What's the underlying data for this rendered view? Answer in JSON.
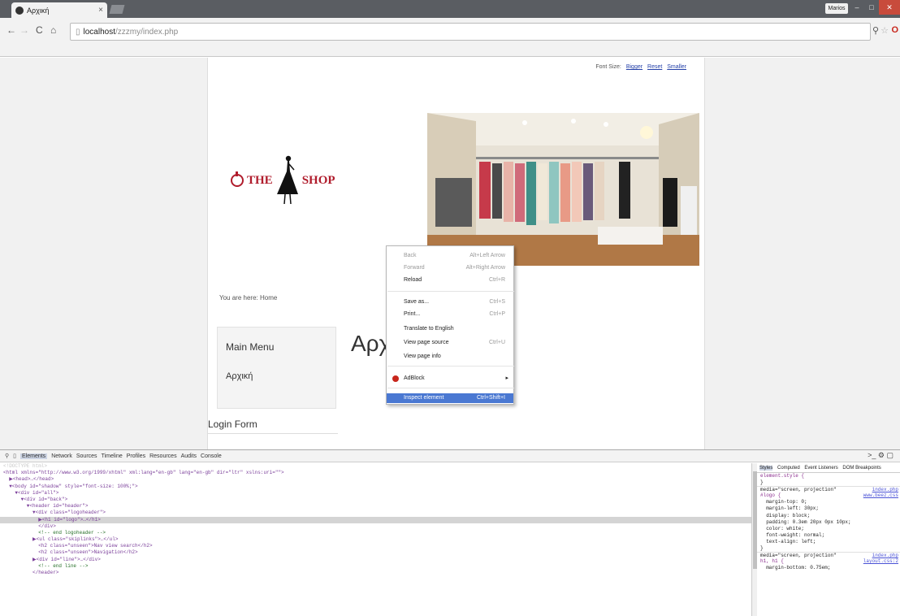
{
  "browser": {
    "tab_title": "Αρχική",
    "tab_close": "×",
    "user_button": "Marios",
    "window_controls": [
      "–",
      "□",
      "✕"
    ],
    "nav_icons": [
      "back-icon",
      "forward-icon",
      "reload-icon",
      "home-icon"
    ],
    "url_host": "localhost",
    "url_path": "/zzzmy/index.php",
    "toolbar_icons": [
      "location-icon",
      "star-icon",
      "opera-icon"
    ]
  },
  "page": {
    "font_size_label": "Font Size:",
    "font_size_links": [
      "Bigger",
      "Reset",
      "Smaller"
    ],
    "logo_the": "THE",
    "logo_shop": "SHOP",
    "breadcrumb": "You are here: Home",
    "main_menu_title": "Main Menu",
    "main_menu_item": "Αρχική",
    "heading": "Αρχ",
    "login_title": "Login Form"
  },
  "context_menu": {
    "items": [
      {
        "label": "Back",
        "shortcut": "Alt+Left Arrow",
        "disabled": true
      },
      {
        "label": "Forward",
        "shortcut": "Alt+Right Arrow",
        "disabled": true
      },
      {
        "label": "Reload",
        "shortcut": "Ctrl+R",
        "disabled": false
      },
      {
        "label": "Save as...",
        "shortcut": "Ctrl+S",
        "disabled": false
      },
      {
        "label": "Print...",
        "shortcut": "Ctrl+P",
        "disabled": false
      },
      {
        "label": "Translate to English",
        "shortcut": "",
        "disabled": false
      },
      {
        "label": "View page source",
        "shortcut": "Ctrl+U",
        "disabled": false
      },
      {
        "label": "View page info",
        "shortcut": "",
        "disabled": false
      },
      {
        "label": "AdBlock",
        "shortcut": "",
        "disabled": false
      },
      {
        "label": "Inspect element",
        "shortcut": "Ctrl+Shift+I",
        "disabled": false
      }
    ]
  },
  "devtools": {
    "tabs": [
      "Elements",
      "Network",
      "Sources",
      "Timeline",
      "Profiles",
      "Resources",
      "Audits",
      "Console"
    ],
    "active_tab": "Elements",
    "right_icons": ">_  ⚙  ▢",
    "dom_lines": [
      "<!DOCTYPE html>",
      "<html xmlns=\"http://www.w3.org/1999/xhtml\" xml:lang=\"en-gb\" lang=\"en-gb\" dir=\"ltr\" xslns:uri=\"\">",
      "  ▶<head>…</head>",
      "  ▼<body id=\"shadow\" style=\"font-size: 100%;\">",
      "    ▼<div id=\"all\">",
      "      ▼<div id=\"back\">",
      "        ▼<header id=\"header\">",
      "          ▼<div class=\"logoheader\">",
      "            ▶<h1 id=\"logo\">…</h1>",
      "            </div>",
      "            <!-- end logoheader -->",
      "          ▶<ul class=\"skiplinks\">…</ul>",
      "            <h2 class=\"unseen\">Nav view search</h2>",
      "            <h2 class=\"unseen\">Navigation</h2>",
      "          ▶<div id=\"line\">…</div>",
      "            <!-- end line -->",
      "          </header>"
    ],
    "styles_tabs": [
      "Styles",
      "Computed",
      "Event Listeners",
      "DOM Breakpoints"
    ],
    "style_lines": [
      {
        "text": "element.style {",
        "src": ""
      },
      {
        "text": "}",
        "src": ""
      },
      {
        "text": "media=\"screen, projection\"",
        "src": "index.php"
      },
      {
        "text": "#logo {",
        "src": "www.beez.css"
      },
      {
        "text": "  margin-top: 0;",
        "src": ""
      },
      {
        "text": "  margin-left: 30px;",
        "src": ""
      },
      {
        "text": "  display: block;",
        "src": ""
      },
      {
        "text": "  padding: 0.3em 20px 0px 10px;",
        "src": ""
      },
      {
        "text": "  color: white;",
        "src": ""
      },
      {
        "text": "  font-weight: normal;",
        "src": ""
      },
      {
        "text": "  text-align: left;",
        "src": ""
      },
      {
        "text": "}",
        "src": ""
      },
      {
        "text": "media=\"screen, projection\"",
        "src": "index.php"
      },
      {
        "text": "h1, h1 {",
        "src": "layout.css:2"
      },
      {
        "text": "  margin-bottom: 0.75em;",
        "src": ""
      }
    ]
  },
  "colors": {
    "brand_red": "#b01c2c",
    "selection_blue": "#4a78d2",
    "link_blue": "#2440a8"
  }
}
